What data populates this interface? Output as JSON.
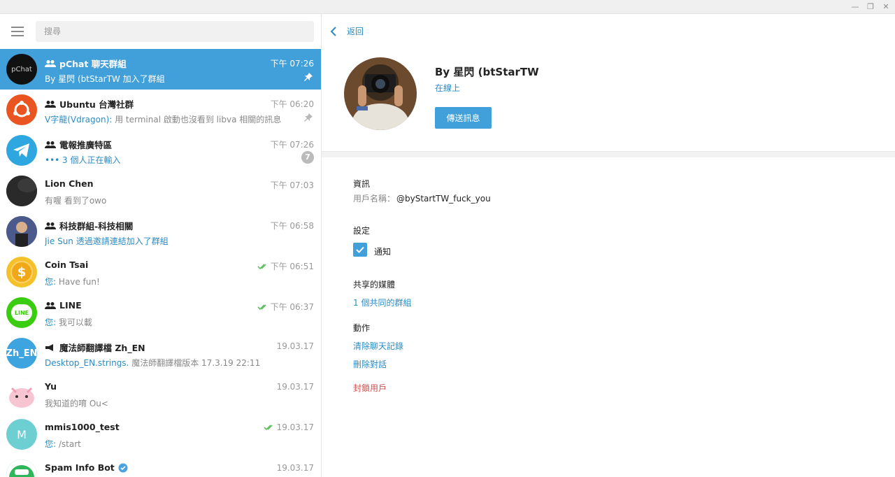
{
  "window": {
    "minimize_glyph": "—",
    "restore_glyph": "❐",
    "close_glyph": "✕"
  },
  "search": {
    "placeholder": "搜尋"
  },
  "chats": [
    {
      "name": "pChat 聊天群組",
      "time": "下午 07:26",
      "sender": "",
      "message": "By 星閃 (btStarTW 加入了群組",
      "pinned": true,
      "group": true,
      "avatar_text": "pChat",
      "avatar_color": "#111111"
    },
    {
      "name": "Ubuntu 台灣社群",
      "time": "下午 06:20",
      "sender": "V字龍(Vdragon):",
      "message": " 用 terminal 啟動也沒看到 libva 相關的訊息",
      "pinned": true,
      "group": true,
      "avatar_text": "",
      "avatar_color": "#e95420"
    },
    {
      "name": "電報推廣特區",
      "time": "下午 07:26",
      "sender": "••• 3 個人正在輸入",
      "message": "",
      "badge": "7",
      "group": true,
      "avatar_text": "",
      "avatar_color": "#2ea6e0"
    },
    {
      "name": "Lion Chen",
      "time": "下午 07:03",
      "sender": "",
      "message": "有喔 看到了owo",
      "avatar_text": "",
      "avatar_color": "#2a2a2a"
    },
    {
      "name": "科技群組-科技相關",
      "time": "下午 06:58",
      "sender": "Jie Sun 透過邀請連結加入了群組",
      "message": "",
      "group": true,
      "avatar_text": "",
      "avatar_color": "#4b5a8a"
    },
    {
      "name": "Coin Tsai",
      "time": "下午 06:51",
      "sender": "您:",
      "message": " Have fun!",
      "read": true,
      "avatar_text": "$",
      "avatar_color": "#f5c12b"
    },
    {
      "name": "LINE",
      "time": "下午 06:37",
      "sender": "您:",
      "message": " 我可以載",
      "read": true,
      "group": true,
      "avatar_text": "LINE",
      "avatar_color": "#3acd0f"
    },
    {
      "name": "魔法師翻譯檔 Zh_EN",
      "time": "19.03.17",
      "sender": "Desktop_EN.strings.",
      "message": " 魔法師翻譯檔版本 17.3.19 22:11",
      "channel": true,
      "avatar_text": "Zh_EN",
      "avatar_color": "#3da4e0"
    },
    {
      "name": "Yu",
      "time": "19.03.17",
      "sender": "",
      "message": "我知道的唷 Ou<",
      "avatar_text": "",
      "avatar_color": "#f7d4dc"
    },
    {
      "name": "mmis1000_test",
      "time": "19.03.17",
      "sender": "您:",
      "message": " /start",
      "read": true,
      "avatar_text": "M",
      "avatar_color": "#6ecfd3"
    },
    {
      "name": "Spam Info Bot",
      "time": "19.03.17",
      "sender": "",
      "message": "",
      "verified": true,
      "avatar_text": "",
      "avatar_color": "#2fb55a"
    }
  ],
  "profile": {
    "back_label": "返回",
    "name": "By 星閃 (btStarTW",
    "status": "在線上",
    "send_button": "傳送訊息"
  },
  "info": {
    "title": "資訊",
    "username_label": "用戶名稱：",
    "username": "@byStartTW_fuck_you"
  },
  "settings": {
    "title": "設定",
    "notify_label": "通知",
    "notify_checked": true
  },
  "shared": {
    "title": "共享的媒體",
    "groups_link": "1 個共同的群組"
  },
  "actions": {
    "title": "動作",
    "clear_history": "清除聊天記錄",
    "delete_chat": "刪除對話",
    "block_user": "封鎖用戶"
  }
}
